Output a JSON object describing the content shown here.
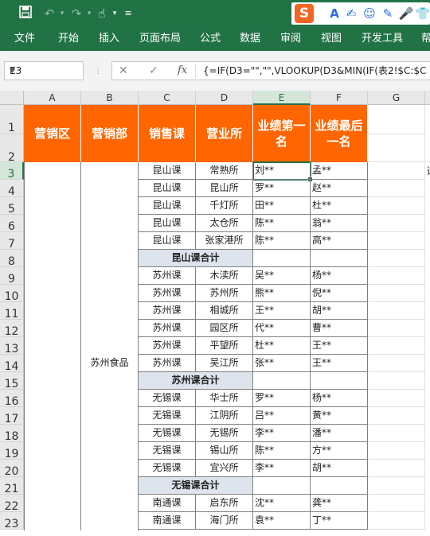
{
  "quick_access": {
    "save_icon": "save-icon",
    "undo_icon": "undo-icon",
    "redo_icon": "redo-icon",
    "touch_icon": "touch-mode-icon",
    "customize_icon": "customize-dropdown-icon"
  },
  "ime_toolbar": {
    "logo": "S",
    "icons": [
      "A",
      "✍",
      "☺",
      "✎",
      "🎤",
      "👕"
    ]
  },
  "menu": [
    "文件",
    "开始",
    "插入",
    "页面布局",
    "公式",
    "数据",
    "审阅",
    "视图",
    "开发工具",
    "帮"
  ],
  "formula_bar": {
    "name_box": "E3",
    "cancel": "✕",
    "enter": "✓",
    "fx": "fx",
    "formula": "{=IF(D3=\"\",\"\",VLOOKUP(D3&MIN(IF(表2!$C:$C"
  },
  "columns": [
    "A",
    "B",
    "C",
    "D",
    "E",
    "F",
    "G"
  ],
  "rows": [
    "1",
    "2",
    "3",
    "4",
    "5",
    "6",
    "7",
    "8",
    "9",
    "10",
    "11",
    "12",
    "13",
    "14",
    "15",
    "16",
    "17",
    "18",
    "19",
    "20",
    "21",
    "22",
    "23"
  ],
  "header": {
    "a": "营销区",
    "b": "营销部",
    "c": "销售课",
    "d": "营业所",
    "e": "业绩第一名",
    "f": "业绩最后一名"
  },
  "merged_b": "苏州食品",
  "table_rows": [
    {
      "c": "昆山课",
      "d": "常熟所",
      "e": "刘**",
      "f": "孟**"
    },
    {
      "c": "昆山课",
      "d": "昆山所",
      "e": "罗**",
      "f": "赵**"
    },
    {
      "c": "昆山课",
      "d": "千灯所",
      "e": "田**",
      "f": "杜**"
    },
    {
      "c": "昆山课",
      "d": "太仓所",
      "e": "陈**",
      "f": "翁**"
    },
    {
      "c": "昆山课",
      "d": "张家港所",
      "e": "陈**",
      "f": "高**"
    },
    {
      "subtotal": "昆山课合计"
    },
    {
      "c": "苏州课",
      "d": "木渎所",
      "e": "吴**",
      "f": "杨**"
    },
    {
      "c": "苏州课",
      "d": "苏州所",
      "e": "熊**",
      "f": "倪**"
    },
    {
      "c": "苏州课",
      "d": "相城所",
      "e": "王**",
      "f": "胡**"
    },
    {
      "c": "苏州课",
      "d": "园区所",
      "e": "代**",
      "f": "曹**"
    },
    {
      "c": "苏州课",
      "d": "平望所",
      "e": "杜**",
      "f": "王**"
    },
    {
      "c": "苏州课",
      "d": "吴江所",
      "e": "张**",
      "f": "王**"
    },
    {
      "subtotal": "苏州课合计"
    },
    {
      "c": "无锡课",
      "d": "华士所",
      "e": "罗**",
      "f": "杨**"
    },
    {
      "c": "无锡课",
      "d": "江阴所",
      "e": "吕**",
      "f": "黄**"
    },
    {
      "c": "无锡课",
      "d": "无锡所",
      "e": "李**",
      "f": "潘**"
    },
    {
      "c": "无锡课",
      "d": "锡山所",
      "e": "陈**",
      "f": "方**"
    },
    {
      "c": "无锡课",
      "d": "宜兴所",
      "e": "李**",
      "f": "胡**"
    },
    {
      "subtotal": "无锡课合计"
    },
    {
      "c": "南通课",
      "d": "启东所",
      "e": "沈**",
      "f": "龚**"
    },
    {
      "c": "南通课",
      "d": "海门所",
      "e": "袁**",
      "f": "丁**"
    }
  ],
  "overflow_g3": "选"
}
